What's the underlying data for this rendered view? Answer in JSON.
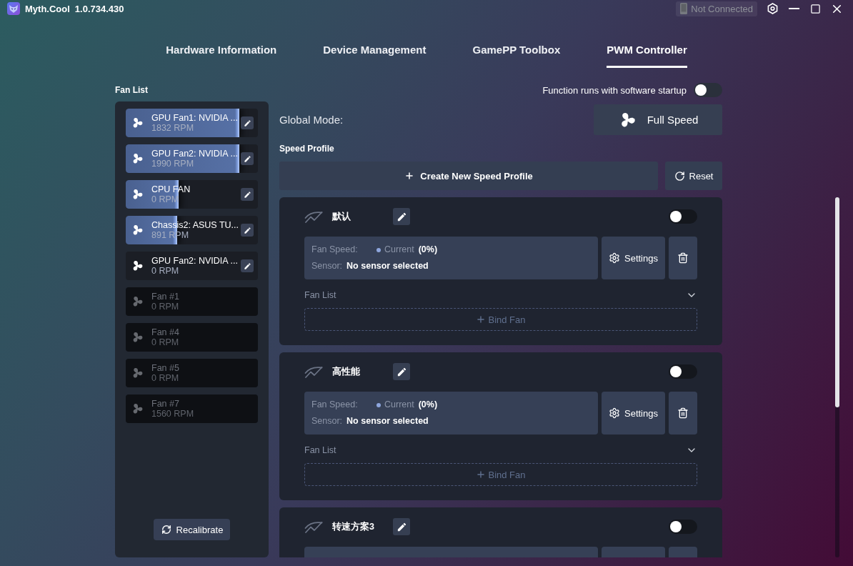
{
  "window": {
    "app_name": "Myth.Cool",
    "version": "1.0.734.430",
    "connection_status": "Not Connected"
  },
  "tabs": [
    {
      "label": "Hardware Information",
      "selected": false
    },
    {
      "label": "Device Management",
      "selected": false
    },
    {
      "label": "GamePP Toolbox",
      "selected": false
    },
    {
      "label": "PWM Controller",
      "selected": true
    }
  ],
  "fan_list": {
    "title": "Fan List",
    "fans": [
      {
        "name": "GPU Fan1: NVIDIA ...",
        "rpm": "1832 RPM",
        "level": 0.86,
        "disabled": false
      },
      {
        "name": "GPU Fan2: NVIDIA ...",
        "rpm": "1990 RPM",
        "level": 0.86,
        "disabled": false
      },
      {
        "name": "CPU FAN",
        "rpm": "0 RPM",
        "level": 0.4,
        "disabled": false
      },
      {
        "name": "Chassis2: ASUS TU...",
        "rpm": "891 RPM",
        "level": 0.39,
        "disabled": false
      },
      {
        "name": "GPU Fan2: NVIDIA ...",
        "rpm": "0 RPM",
        "disabled": false
      },
      {
        "name": "Fan #1",
        "rpm": "0 RPM",
        "disabled": true
      },
      {
        "name": "Fan #4",
        "rpm": "0 RPM",
        "disabled": true
      },
      {
        "name": "Fan #5",
        "rpm": "0 RPM",
        "disabled": true
      },
      {
        "name": "Fan #7",
        "rpm": "1560 RPM",
        "disabled": true
      }
    ],
    "recalibrate_button": "Recalibrate"
  },
  "startup_toggle": {
    "label": "Function runs with software startup",
    "on": false
  },
  "global_mode": {
    "label": "Global Mode:",
    "value": "Full Speed"
  },
  "speed_profile": {
    "title": "Speed Profile",
    "create_button": "Create New Speed Profile",
    "reset_button": "Reset",
    "profiles": [
      {
        "name": "默认",
        "on": false,
        "fan_speed_label": "Fan Speed:",
        "current_label": "Current",
        "current_value": "(0%)",
        "sensor_label": "Sensor:",
        "sensor_value": "No sensor selected",
        "settings_button": "Settings",
        "fan_list_label": "Fan List",
        "bind_button": "Bind Fan"
      },
      {
        "name": "高性能",
        "on": false,
        "fan_speed_label": "Fan Speed:",
        "current_label": "Current",
        "current_value": "(0%)",
        "sensor_label": "Sensor:",
        "sensor_value": "No sensor selected",
        "settings_button": "Settings",
        "fan_list_label": "Fan List",
        "bind_button": "Bind Fan"
      },
      {
        "name": "转速方案3",
        "on": false
      }
    ]
  }
}
